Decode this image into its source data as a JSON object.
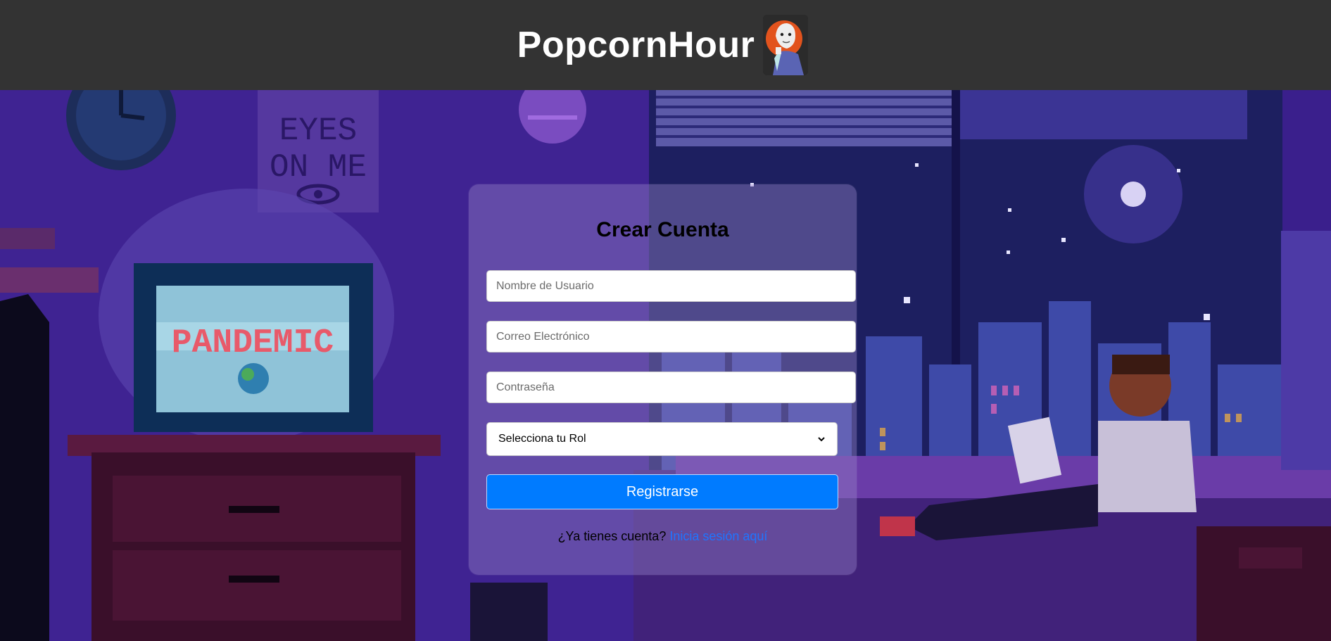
{
  "header": {
    "title": "PopcornHour"
  },
  "form": {
    "title": "Crear Cuenta",
    "username_placeholder": "Nombre de Usuario",
    "email_placeholder": "Correo Electrónico",
    "password_placeholder": "Contraseña",
    "role_select_value": "Selecciona tu Rol",
    "submit_label": "Registrarse",
    "login_prompt": "¿Ya tienes cuenta?",
    "login_link": "Inicia sesión aquí"
  },
  "background": {
    "poster_text": [
      "EYES",
      "ON ME"
    ],
    "tv_text": "PANDEMIC"
  },
  "colors": {
    "header_bg": "#333333",
    "button_bg": "#007bff",
    "link": "#1f75ff",
    "scene_primary": "#3a1f8c"
  }
}
